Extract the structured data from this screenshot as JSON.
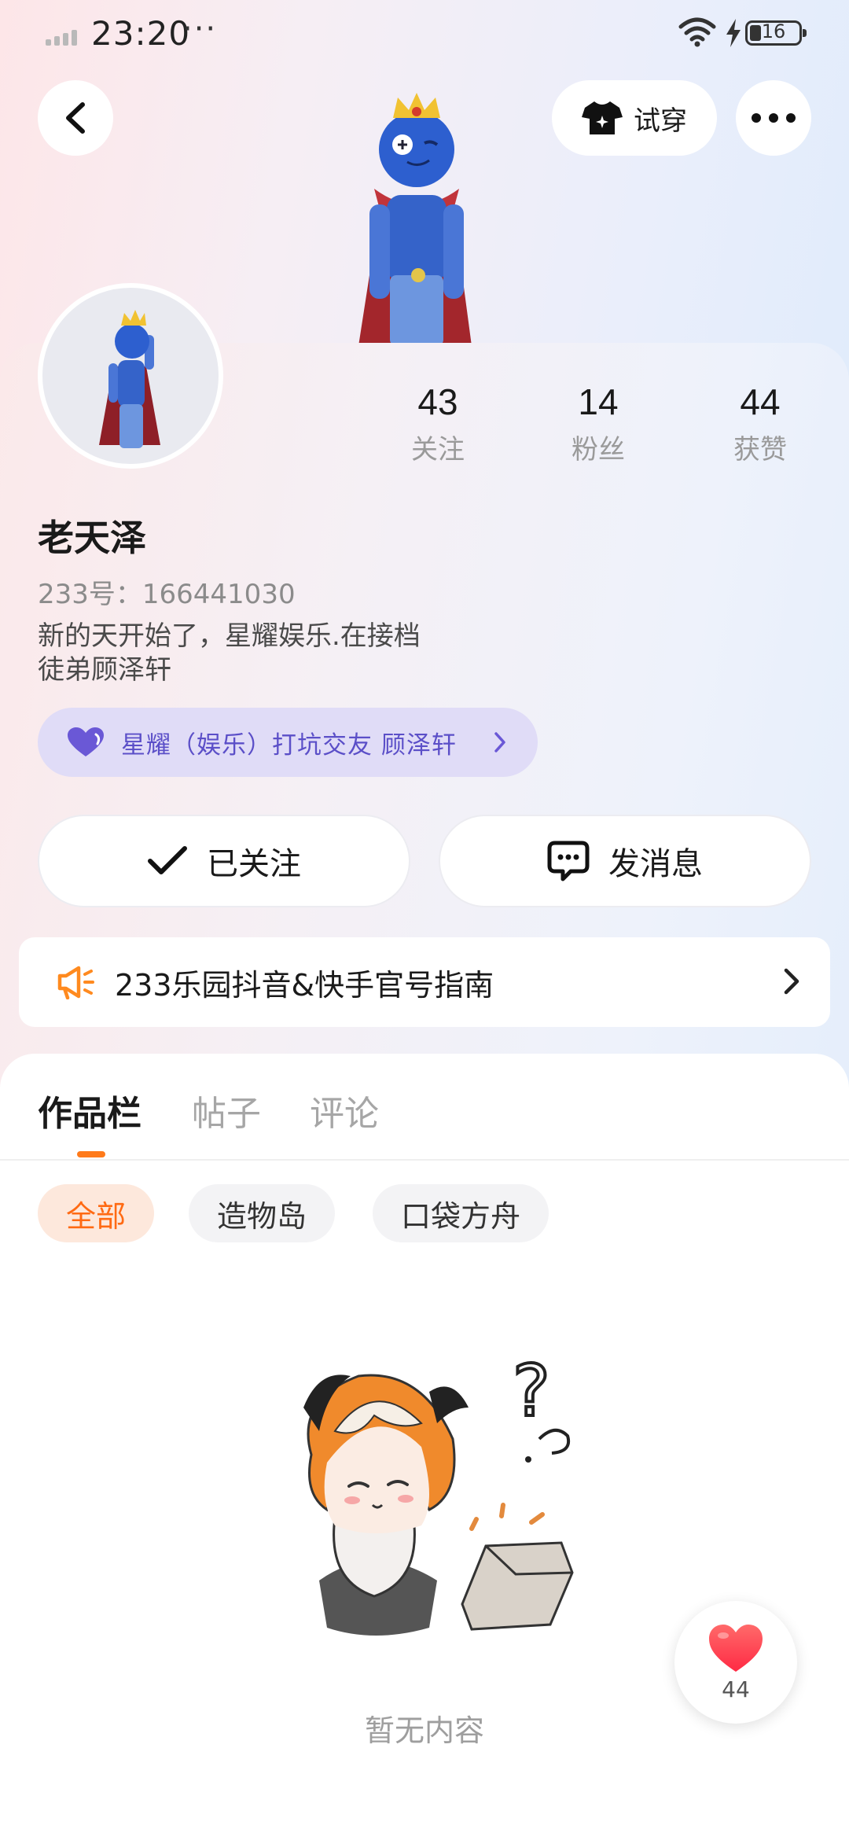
{
  "status_bar": {
    "time": "23:20",
    "dots": "···",
    "battery": "16"
  },
  "header": {
    "try_on_label": "试穿"
  },
  "profile": {
    "name": "老天泽",
    "uid": "233号：166441030",
    "bio_line1": "新的天开始了，星耀娱乐.在接档",
    "bio_line2": "徒弟顾泽轩",
    "group": "星耀（娱乐）打坑交友 顾泽轩"
  },
  "stats": [
    {
      "value": "43",
      "label": "关注"
    },
    {
      "value": "14",
      "label": "粉丝"
    },
    {
      "value": "44",
      "label": "获赞"
    }
  ],
  "actions": {
    "followed_label": "已关注",
    "message_label": "发消息"
  },
  "notice": {
    "text": "233乐园抖音&快手官号指南"
  },
  "tabs": [
    "作品栏",
    "帖子",
    "评论"
  ],
  "filters": [
    "全部",
    "造物岛",
    "口袋方舟"
  ],
  "empty_text": "暂无内容",
  "like_count": "44",
  "colors": {
    "accent": "#ff7a1a",
    "group_text": "#5b4fc8",
    "group_bg": "#e0dcf7",
    "like": "#ff3d4f"
  },
  "icons": {
    "back": "chevron-left-icon",
    "tryon": "tshirt-icon",
    "more": "more-dots-icon",
    "group": "heart-icon",
    "followed": "check-icon",
    "message": "chat-bubble-icon",
    "notice": "megaphone-icon",
    "fab": "heart-icon"
  }
}
